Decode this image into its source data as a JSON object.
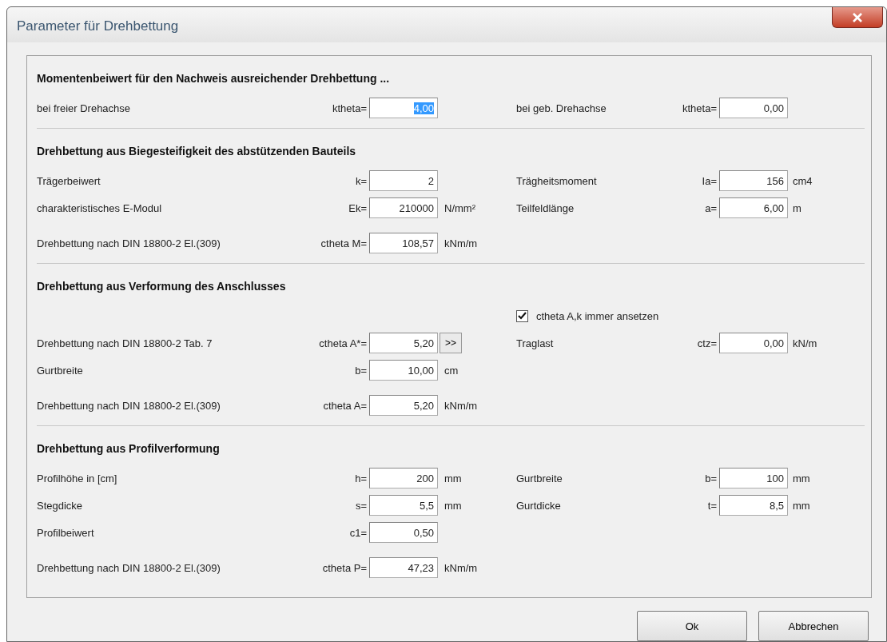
{
  "window": {
    "title": "Parameter für Drehbettung"
  },
  "sections": [
    {
      "title": "Momentenbeiwert für den Nachweis ausreichender Drehbettung ...",
      "rows": [
        {
          "left": {
            "kind": "field",
            "label": "bei freier Drehachse",
            "eq": "ktheta=",
            "value": "4,00",
            "selected": true
          },
          "right": {
            "kind": "field",
            "label": "bei geb. Drehachse",
            "eq": "ktheta=",
            "value": "0,00",
            "selected": false
          }
        }
      ]
    },
    {
      "title": "Drehbettung aus Biegesteifigkeit des abstützenden Bauteils",
      "rows": [
        {
          "left": {
            "kind": "field",
            "label": "Trägerbeiwert",
            "eq": "k=",
            "value": "2",
            "selected": false
          },
          "right": {
            "kind": "field",
            "label": "Trägheitsmoment",
            "eq": "Ia=",
            "value": "156",
            "unit": "cm4",
            "selected": false
          }
        },
        {
          "left": {
            "kind": "field",
            "label": "charakteristisches E-Modul",
            "eq": "Ek=",
            "value": "210000",
            "unit": "N/mm²",
            "selected": false
          },
          "right": {
            "kind": "field",
            "label": "Teilfeldlänge",
            "eq": "a=",
            "value": "6,00",
            "unit": "m",
            "selected": false
          }
        },
        {
          "left": {
            "kind": "field",
            "label": "Drehbettung nach DIN 18800-2 El.(309)",
            "eq": "ctheta M=",
            "value": "108,57",
            "unit": "kNm/m",
            "selected": false
          }
        }
      ]
    },
    {
      "title": "Drehbettung aus Verformung des Anschlusses",
      "rows": [
        {
          "right": {
            "kind": "checkbox",
            "label": "ctheta A,k immer ansetzen",
            "checked": true
          }
        },
        {
          "left": {
            "kind": "field",
            "label": "Drehbettung nach DIN 18800-2 Tab. 7",
            "eq": "ctheta A*=",
            "value": "5,20",
            "button": ">>",
            "selected": false
          },
          "right": {
            "kind": "field",
            "label": "Traglast",
            "eq": "ctz=",
            "value": "0,00",
            "unit": "kN/m",
            "selected": false
          }
        },
        {
          "left": {
            "kind": "field",
            "label": "Gurtbreite",
            "eq": "b=",
            "value": "10,00",
            "unit": "cm",
            "selected": false
          }
        },
        {
          "left": {
            "kind": "field",
            "label": "Drehbettung nach DIN 18800-2 El.(309)",
            "eq": "ctheta A=",
            "value": "5,20",
            "unit": "kNm/m",
            "selected": false
          }
        }
      ]
    },
    {
      "title": "Drehbettung aus Profilverformung",
      "rows": [
        {
          "left": {
            "kind": "field",
            "label": "Profilhöhe in [cm]",
            "eq": "h=",
            "value": "200",
            "unit": "mm",
            "selected": false
          },
          "right": {
            "kind": "field",
            "label": "Gurtbreite",
            "eq": "b=",
            "value": "100",
            "unit": "mm",
            "selected": false
          }
        },
        {
          "left": {
            "kind": "field",
            "label": "Stegdicke",
            "eq": "s=",
            "value": "5,5",
            "unit": "mm",
            "selected": false
          },
          "right": {
            "kind": "field",
            "label": "Gurtdicke",
            "eq": "t=",
            "value": "8,5",
            "unit": "mm",
            "selected": false
          }
        },
        {
          "left": {
            "kind": "field",
            "label": "Profilbeiwert",
            "eq": "c1=",
            "value": "0,50",
            "selected": false
          }
        },
        {
          "left": {
            "kind": "field",
            "label": "Drehbettung nach DIN 18800-2 El.(309)",
            "eq": "ctheta P=",
            "value": "47,23",
            "unit": "kNm/m",
            "selected": false
          }
        }
      ]
    }
  ],
  "buttons": [
    "Ok",
    "Abbrechen"
  ]
}
